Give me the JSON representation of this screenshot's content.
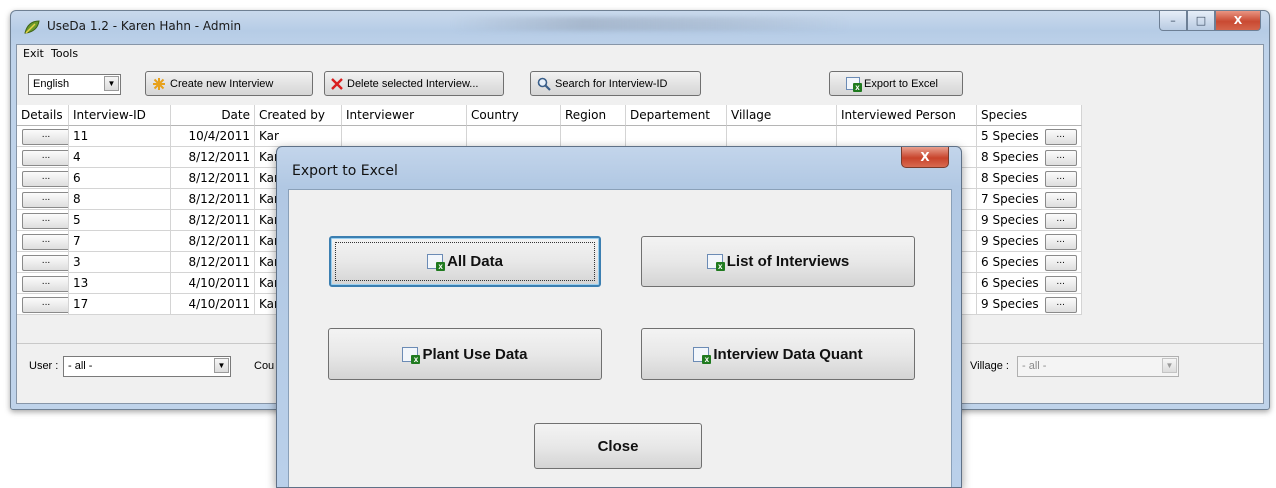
{
  "window": {
    "title": "UseDa 1.2 - Karen Hahn - Admin",
    "minimize_glyph": "–",
    "maximize_glyph": "□",
    "close_glyph": "X"
  },
  "menu": {
    "items": [
      "Exit",
      "Tools"
    ]
  },
  "toolbar": {
    "language": "English",
    "create_label": "Create new Interview",
    "delete_label": "Delete selected Interview...",
    "search_label": "Search for Interview-ID",
    "export_label": "Export to Excel"
  },
  "grid": {
    "columns": [
      "Details",
      "Interview-ID",
      "Date",
      "Created by",
      "Interviewer",
      "Country",
      "Region",
      "Departement",
      "Village",
      "Interviewed Person",
      "Species"
    ],
    "details_glyph": "...",
    "species_btn_glyph": "...",
    "rows": [
      {
        "id": "11",
        "date": "10/4/2011",
        "created_by": "Kar",
        "species": "5 Species"
      },
      {
        "id": "4",
        "date": "8/12/2011",
        "created_by": "Kar",
        "species": "8 Species"
      },
      {
        "id": "6",
        "date": "8/12/2011",
        "created_by": "Kar",
        "species": "8 Species"
      },
      {
        "id": "8",
        "date": "8/12/2011",
        "created_by": "Kar",
        "species": "7 Species"
      },
      {
        "id": "5",
        "date": "8/12/2011",
        "created_by": "Kar",
        "species": "9 Species"
      },
      {
        "id": "7",
        "date": "8/12/2011",
        "created_by": "Kar",
        "species": "9 Species"
      },
      {
        "id": "3",
        "date": "8/12/2011",
        "created_by": "Kar",
        "species": "6 Species"
      },
      {
        "id": "13",
        "date": "4/10/2011",
        "created_by": "Kar",
        "species": "6 Species"
      },
      {
        "id": "17",
        "date": "4/10/2011",
        "created_by": "Kar",
        "species": "9 Species"
      }
    ]
  },
  "filters": {
    "user_label": "User :",
    "user_value": "- all -",
    "country_label": "Cou",
    "village_label": "Village :",
    "village_value": "- all -"
  },
  "dialog": {
    "title": "Export to Excel",
    "close_glyph": "X",
    "all_data": "All Data",
    "list_interviews": "List of Interviews",
    "plant_use": "Plant Use Data",
    "interview_quant": "Interview Data Quant",
    "close_button": "Close"
  }
}
